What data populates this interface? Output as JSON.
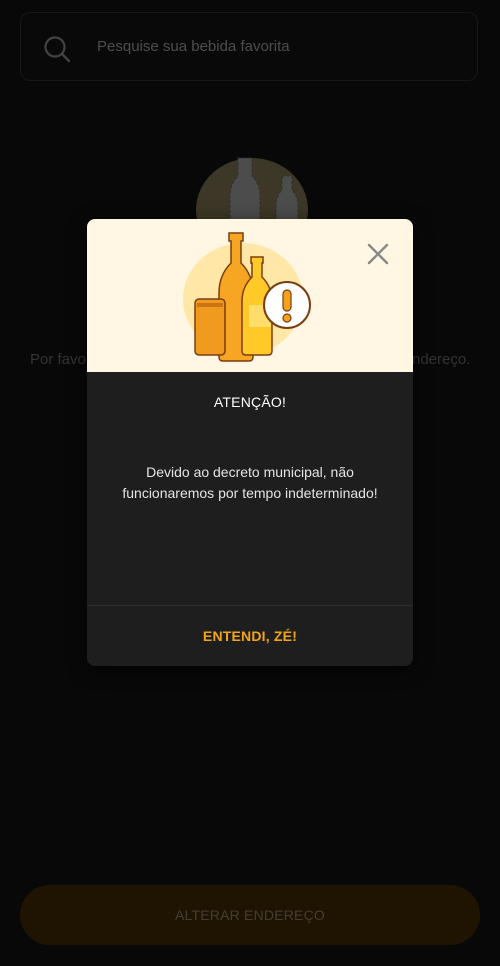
{
  "search": {
    "placeholder": "Pesquise sua bebida favorita",
    "icon": "search-icon"
  },
  "background": {
    "message_left_fragment": "Por favo",
    "message_right_fragment": "ndereço.",
    "illustration": "bottles-icon"
  },
  "bottom_bar": {
    "button_label": "ALTERAR ENDEREÇO"
  },
  "modal": {
    "title": "ATENÇÃO!",
    "message": "Devido ao decreto municipal, não funcionaremos por tempo indeterminado!",
    "action_label": "ENTENDI, ZÉ!",
    "close_icon": "close-icon",
    "illustration": "drinks-warning-icon"
  },
  "colors": {
    "accent": "#f3a51a",
    "modal_header_bg": "#fff7e3",
    "modal_bg": "#1e1e1e",
    "page_bg": "#101010",
    "button_bg": "#3a2604"
  }
}
